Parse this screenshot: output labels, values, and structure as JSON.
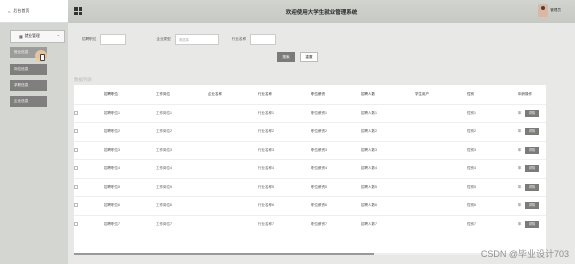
{
  "header": {
    "brand_label": "后台首页",
    "system_title": "欢迎使用大学生就业管理系统",
    "user_name": "管理员"
  },
  "sidebar": {
    "menu_label": "就业管理",
    "items": [
      {
        "label": "就业信息"
      },
      {
        "label": "岗位信息"
      },
      {
        "label": "求职信息"
      },
      {
        "label": "企业信息"
      }
    ]
  },
  "search": {
    "job_label": "招聘职位",
    "job_value": "",
    "company_type_label": "企业类型",
    "company_type_placeholder": "请选择",
    "industry_label": "行业名称",
    "industry_value": "",
    "search_button": "搜索",
    "reset_button": "重置"
  },
  "section_title": "数据列表",
  "table": {
    "columns": [
      "",
      "招聘职位",
      "工作岗位",
      "企业名称",
      "行业名称",
      "职位薪资",
      "招聘人数",
      "学生用户",
      "性别",
      "年龄",
      "操作"
    ],
    "rows": [
      {
        "job": "招聘职位1",
        "post": "工作岗位1",
        "company": "",
        "industry": "行业名称1",
        "salary": "职位薪资1",
        "count": "招聘人数1",
        "student": "",
        "gender": "性别1",
        "age": "年",
        "op": "详情"
      },
      {
        "job": "招聘职位2",
        "post": "工作岗位2",
        "company": "",
        "industry": "行业名称2",
        "salary": "职位薪资2",
        "count": "招聘人数2",
        "student": "",
        "gender": "性别2",
        "age": "年",
        "op": "详情"
      },
      {
        "job": "招聘职位3",
        "post": "工作岗位3",
        "company": "",
        "industry": "行业名称3",
        "salary": "职位薪资3",
        "count": "招聘人数3",
        "student": "",
        "gender": "性别3",
        "age": "年",
        "op": "详情"
      },
      {
        "job": "招聘职位4",
        "post": "工作岗位4",
        "company": "",
        "industry": "行业名称4",
        "salary": "职位薪资4",
        "count": "招聘人数4",
        "student": "",
        "gender": "性别4",
        "age": "年",
        "op": "详情"
      },
      {
        "job": "招聘职位5",
        "post": "工作岗位5",
        "company": "",
        "industry": "行业名称5",
        "salary": "职位薪资5",
        "count": "招聘人数5",
        "student": "",
        "gender": "性别5",
        "age": "年",
        "op": "详情"
      },
      {
        "job": "招聘职位6",
        "post": "工作岗位6",
        "company": "",
        "industry": "行业名称6",
        "salary": "职位薪资6",
        "count": "招聘人数6",
        "student": "",
        "gender": "性别6",
        "age": "年",
        "op": "详情"
      },
      {
        "job": "招聘职位7",
        "post": "工作岗位7",
        "company": "",
        "industry": "行业名称7",
        "salary": "职位薪资7",
        "count": "招聘人数7",
        "student": "",
        "gender": "性别7",
        "age": "年",
        "op": "详情"
      }
    ]
  },
  "watermark": "CSDN @毕业设计703",
  "colors": {
    "header_bg": "#c8cac6",
    "sidebar_bg": "#d4d6d2",
    "button_bg": "#7b7c79",
    "main_bg": "#e8e9e7"
  }
}
